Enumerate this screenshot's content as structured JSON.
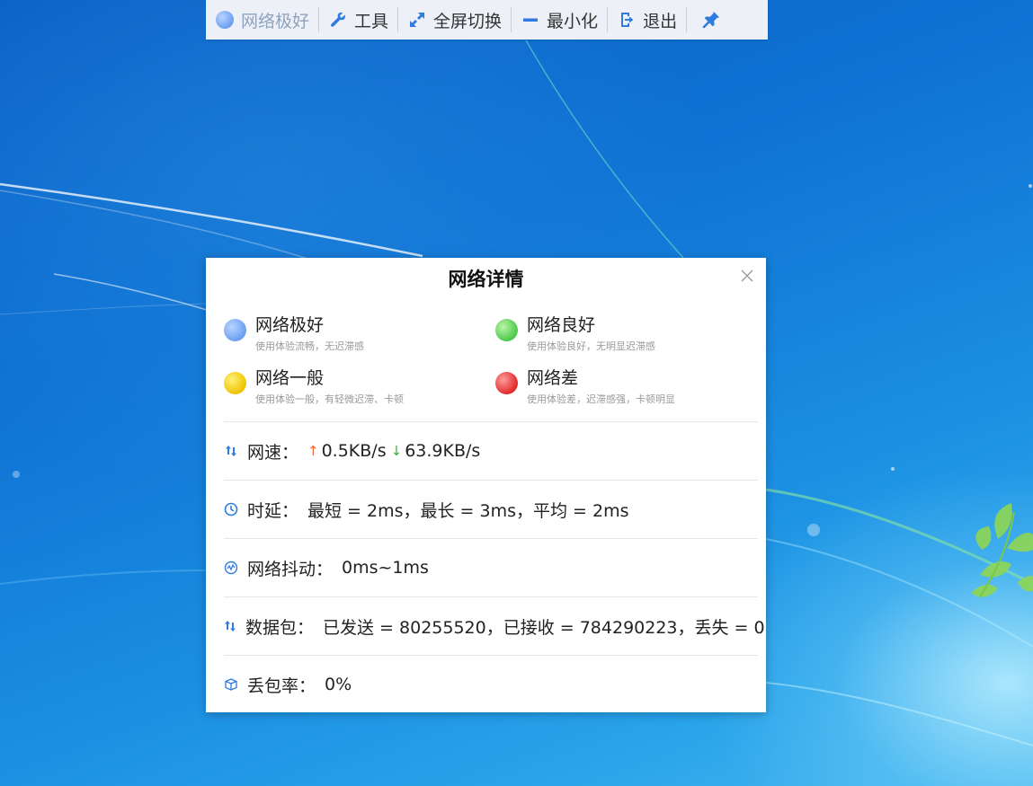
{
  "toolbar": {
    "network_status": "网络极好",
    "tools": "工具",
    "fullscreen": "全屏切换",
    "minimize": "最小化",
    "exit": "退出",
    "colors": {
      "accent": "#2f7be0",
      "status_dim": "#8fa3bd"
    }
  },
  "dialog": {
    "title": "网络详情",
    "legend": [
      {
        "name": "网络极好",
        "desc": "使用体验流畅，无迟滞感",
        "color": "#6b9ff2"
      },
      {
        "name": "网络良好",
        "desc": "使用体验良好，无明显迟滞感",
        "color": "#5ed65a"
      },
      {
        "name": "网络一般",
        "desc": "使用体验一般，有轻微迟滞、卡顿",
        "color": "#f5cc00"
      },
      {
        "name": "网络差",
        "desc": "使用体验差，迟滞感强，卡顿明显",
        "color": "#e63535"
      }
    ],
    "speed": {
      "label": "网速：",
      "up_arrow": "↑",
      "up": "0.5KB/s",
      "down_arrow": "↓",
      "down": "63.9KB/s"
    },
    "latency": {
      "label": "时延：",
      "value": "最短 = 2ms，最长 = 3ms，平均 = 2ms"
    },
    "jitter": {
      "label": "网络抖动：",
      "value": "0ms~1ms"
    },
    "packets": {
      "label": "数据包：",
      "value": "已发送 = 80255520，已接收 = 784290223，丢失 = 0"
    },
    "loss": {
      "label": "丢包率：",
      "value": "0%"
    }
  }
}
